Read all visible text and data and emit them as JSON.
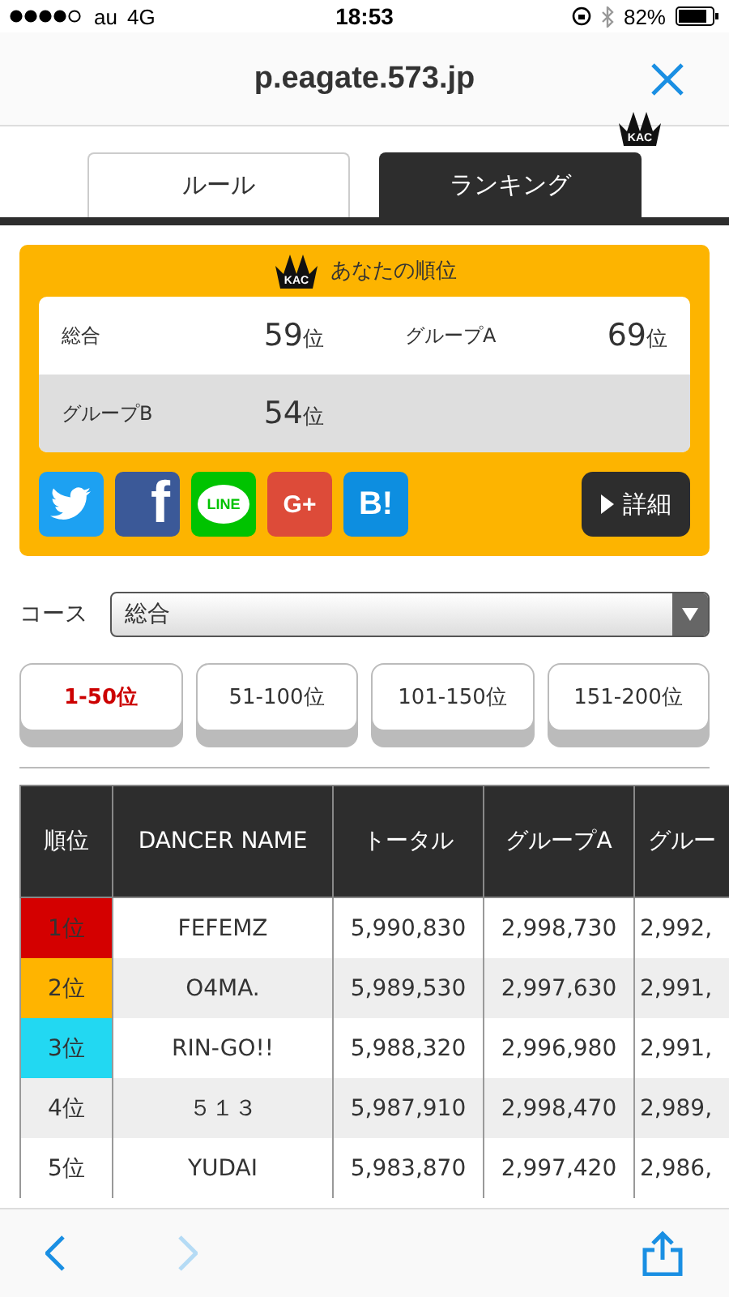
{
  "status_bar": {
    "carrier": "au",
    "network": "4G",
    "time": "18:53",
    "battery": "82%"
  },
  "browser": {
    "address": "p.eagate.573.jp"
  },
  "tabs": [
    {
      "label": "ルール",
      "selected": false
    },
    {
      "label": "ランキング",
      "selected": true,
      "badge": "KAC"
    }
  ],
  "my_rank": {
    "badge": "KAC",
    "title": "あなたの順位",
    "stats": [
      {
        "label": "総合",
        "value": "59",
        "unit": "位"
      },
      {
        "label": "グループA",
        "value": "69",
        "unit": "位"
      },
      {
        "label": "グループB",
        "value": "54",
        "unit": "位"
      }
    ],
    "share": [
      {
        "kind": "twitter"
      },
      {
        "kind": "facebook",
        "label": "f"
      },
      {
        "kind": "line",
        "label": "LINE"
      },
      {
        "kind": "googleplus",
        "label": "G+"
      },
      {
        "kind": "hatena",
        "label": "B!"
      }
    ],
    "details_button": "詳細"
  },
  "course": {
    "label": "コース",
    "value": "総合"
  },
  "ranges": [
    {
      "label": "1-50位",
      "selected": true
    },
    {
      "label": "51-100位",
      "selected": false
    },
    {
      "label": "101-150位",
      "selected": false
    },
    {
      "label": "151-200位",
      "selected": false
    }
  ],
  "table": {
    "columns": [
      "順位",
      "DANCER NAME",
      "トータル",
      "グループA",
      "グルー"
    ],
    "rows": [
      {
        "rank": "1位",
        "color": "#d40000",
        "name": "FEFEMZ",
        "total": "5,990,830",
        "group_a": "2,998,730",
        "column_5": "2,992,"
      },
      {
        "rank": "2位",
        "color": "#ffb400",
        "name": "O4MA.",
        "total": "5,989,530",
        "group_a": "2,997,630",
        "column_5": "2,991,"
      },
      {
        "rank": "3位",
        "color": "#22d8f2",
        "name": "RIN-GO!!",
        "total": "5,988,320",
        "group_a": "2,996,980",
        "column_5": "2,991,"
      },
      {
        "rank": "4位",
        "name": "５１３",
        "total": "5,987,910",
        "group_a": "2,998,470",
        "column_5": "2,989,"
      },
      {
        "rank": "5位",
        "name": "YUDAI",
        "total": "5,983,870",
        "group_a": "2,997,420",
        "column_5": "2,986,"
      }
    ]
  }
}
